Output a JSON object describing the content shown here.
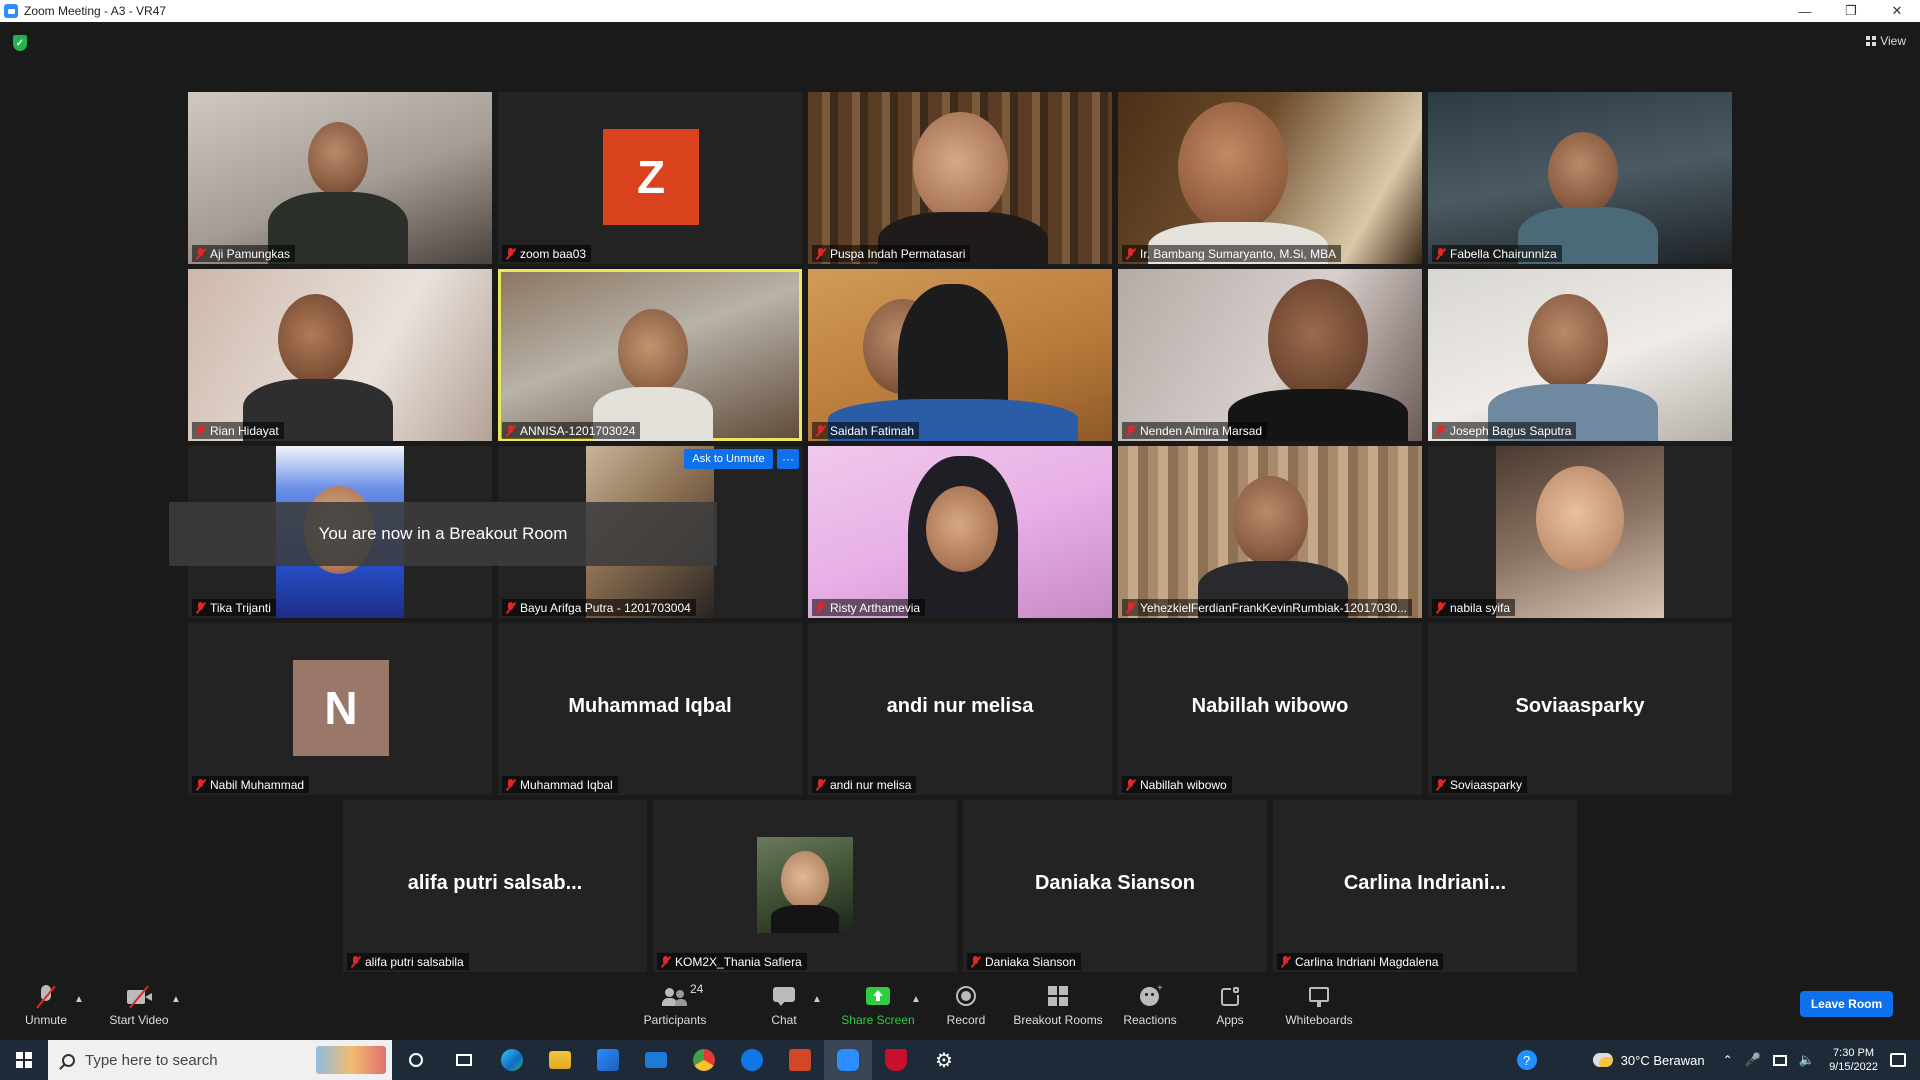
{
  "window": {
    "title": "Zoom Meeting - A3 - VR47"
  },
  "view": {
    "label": "View"
  },
  "tiles_row1": [
    {
      "name": "Aji Pamungkas"
    },
    {
      "name": "zoom baa03",
      "avatar_letter": "Z"
    },
    {
      "name": "Puspa Indah Permatasari"
    },
    {
      "name": "Ir. Bambang Sumaryanto, M.Si, MBA"
    },
    {
      "name": "Fabella Chairunniza"
    }
  ],
  "tiles_row2": [
    {
      "name": "Rian Hidayat"
    },
    {
      "name": "ANNISA-1201703024"
    },
    {
      "name": "Saidah Fatimah"
    },
    {
      "name": "Nenden Almira Marsad"
    },
    {
      "name": "Joseph Bagus Saputra"
    }
  ],
  "tiles_row3": [
    {
      "name": "Tika Trijanti"
    },
    {
      "name": "Bayu Arifga Putra - 1201703004"
    },
    {
      "name": "Risty Arthamevia"
    },
    {
      "name": "YehezkielFerdianFrankKevinRumbiak-12017030..."
    },
    {
      "name": "nabila syifa"
    }
  ],
  "tiles_row4": [
    {
      "name": "Nabil Muhammad",
      "avatar_letter": "N"
    },
    {
      "name": "Muhammad Iqbal",
      "center_label": "Muhammad Iqbal"
    },
    {
      "name": "andi nur melisa",
      "center_label": "andi nur melisa"
    },
    {
      "name": "Nabillah wibowo",
      "center_label": "Nabillah wibowo"
    },
    {
      "name": "Soviaasparky",
      "center_label": "Soviaasparky"
    }
  ],
  "tiles_row5": [
    {
      "name": "alifa putri salsabila",
      "center_label": "alifa putri salsab..."
    },
    {
      "name": "KOM2X_Thania Safiera"
    },
    {
      "name": "Daniaka Sianson",
      "center_label": "Daniaka Sianson"
    },
    {
      "name": "Carlina Indriani Magdalena",
      "center_label": "Carlina  Indriani..."
    }
  ],
  "ask_unmute": {
    "label": "Ask to Unmute",
    "more": "···"
  },
  "toast": {
    "message": "You are now in a Breakout Room"
  },
  "toolbar": {
    "unmute": "Unmute",
    "start_video": "Start Video",
    "participants": "Participants",
    "participants_count": "24",
    "chat": "Chat",
    "share_screen": "Share Screen",
    "record": "Record",
    "breakout_rooms": "Breakout Rooms",
    "reactions": "Reactions",
    "apps": "Apps",
    "whiteboards": "Whiteboards",
    "leave": "Leave Room"
  },
  "taskbar": {
    "search_placeholder": "Type here to search",
    "weather": "30°C  Berawan",
    "time": "7:30 PM",
    "date": "9/15/2022"
  },
  "colors": {
    "accent_blue": "#0e71eb",
    "share_green": "#2ecc40",
    "mute_red": "#e02828",
    "active_speaker": "#e8e85a"
  }
}
